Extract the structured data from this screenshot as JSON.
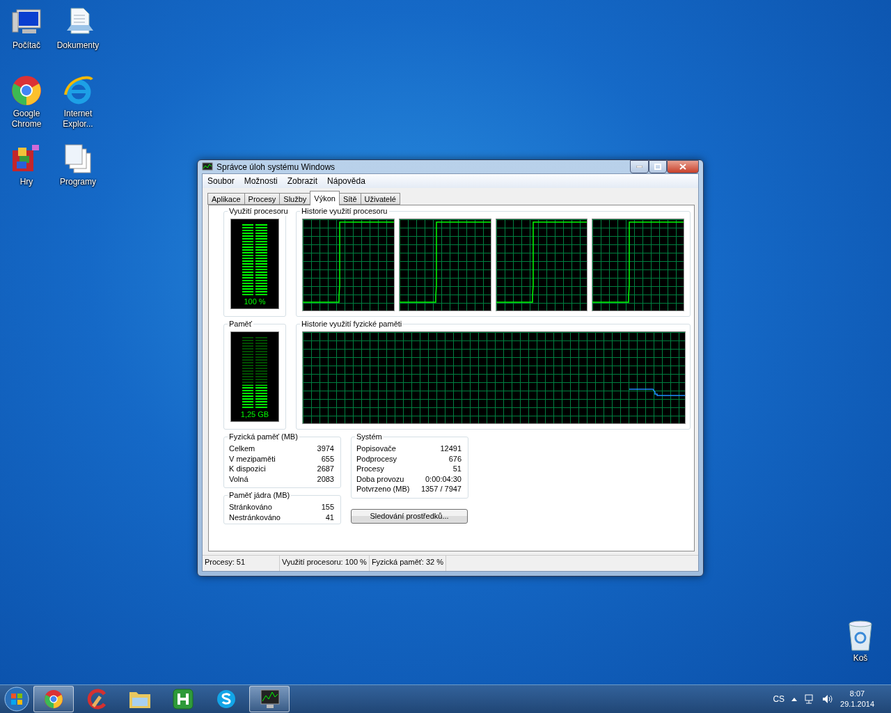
{
  "desktop": {
    "icons": [
      {
        "label": "Počítač",
        "kind": "computer"
      },
      {
        "label": "Dokumenty",
        "kind": "documents"
      },
      {
        "label": "Google Chrome",
        "kind": "chrome"
      },
      {
        "label": "Internet Explor...",
        "kind": "ie"
      },
      {
        "label": "Hry",
        "kind": "games"
      },
      {
        "label": "Programy",
        "kind": "programs"
      },
      {
        "label": "Koš",
        "kind": "bin"
      }
    ]
  },
  "window": {
    "title": "Správce úloh systému Windows",
    "menu": [
      "Soubor",
      "Možnosti",
      "Zobrazit",
      "Nápověda"
    ],
    "tabs": [
      {
        "label": "Aplikace",
        "selected": false
      },
      {
        "label": "Procesy",
        "selected": false
      },
      {
        "label": "Služby",
        "selected": false
      },
      {
        "label": "Výkon",
        "selected": true
      },
      {
        "label": "Sítě",
        "selected": false
      },
      {
        "label": "Uživatelé",
        "selected": false
      }
    ],
    "cpu_usage": {
      "title": "Využití procesoru",
      "reading": "100 %",
      "level": 1
    },
    "cpu_history": {
      "title": "Historie využití procesoru"
    },
    "memory": {
      "title": "Paměť",
      "reading": "1,25 GB",
      "level": 0.32
    },
    "memory_history": {
      "title": "Historie využití fyzické paměti"
    },
    "physical_memory": {
      "title": "Fyzická paměť (MB)",
      "rows": [
        {
          "label": "Celkem",
          "value": "3974"
        },
        {
          "label": "V mezipaměti",
          "value": "655"
        },
        {
          "label": "K dispozici",
          "value": "2687"
        },
        {
          "label": "Volná",
          "value": "2083"
        }
      ]
    },
    "kernel_memory": {
      "title": "Paměť jádra (MB)",
      "rows": [
        {
          "label": "Stránkováno",
          "value": "155"
        },
        {
          "label": "Nestránkováno",
          "value": "41"
        }
      ]
    },
    "system": {
      "title": "Systém",
      "rows": [
        {
          "label": "Popisovače",
          "value": "12491"
        },
        {
          "label": "Podprocesy",
          "value": "676"
        },
        {
          "label": "Procesy",
          "value": "51"
        },
        {
          "label": "Doba provozu",
          "value": "0:00:04:30"
        },
        {
          "label": "Potvrzeno (MB)",
          "value": "1357 / 7947"
        }
      ]
    },
    "resource_button": "Sledování prostředků...",
    "status_bar": [
      "Procesy: 51",
      "Využití procesoru: 100 %",
      "Fyzická paměť: 32 %"
    ]
  },
  "taskbar": {
    "apps": [
      {
        "kind": "chrome",
        "running": true
      },
      {
        "kind": "cleaner",
        "running": false
      },
      {
        "kind": "explorer",
        "running": false
      },
      {
        "kind": "h",
        "running": false
      },
      {
        "kind": "skype",
        "running": false
      },
      {
        "kind": "taskmgr",
        "running": true
      }
    ],
    "language": "CS",
    "time": "8:07",
    "date": "29.1.2014"
  }
}
